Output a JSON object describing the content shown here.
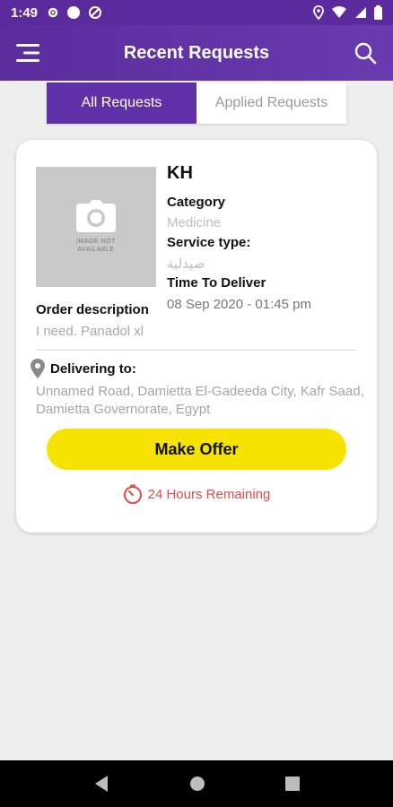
{
  "status_bar": {
    "time": "1:49"
  },
  "app_bar": {
    "title": "Recent Requests",
    "menu_icon": "menu-icon",
    "search_icon": "search-icon"
  },
  "tabs": [
    {
      "label": "All Requests",
      "active": true
    },
    {
      "label": "Applied Requests",
      "active": false
    }
  ],
  "request": {
    "image_placeholder": "IMAGE NOT AVAILABLE",
    "name": "KH",
    "category_label": "Category",
    "category_value": "Medicine",
    "service_label": "Service type:",
    "service_value": "صيدلية",
    "time_label": "Time To Deliver",
    "time_value": "08 Sep 2020 - 01:45 pm",
    "description_label": "Order description",
    "description_value": "I need. Panadol xl",
    "delivering_label": "Delivering to:",
    "address": "Unnamed Road, Damietta El-Gadeeda City, Kafr Saad, Damietta Governorate, Egypt",
    "offer_button": "Make Offer",
    "remaining": "24 Hours Remaining"
  },
  "colors": {
    "primary": "#5f30a8",
    "accent": "#f6e300",
    "warning": "#e04b4b"
  }
}
